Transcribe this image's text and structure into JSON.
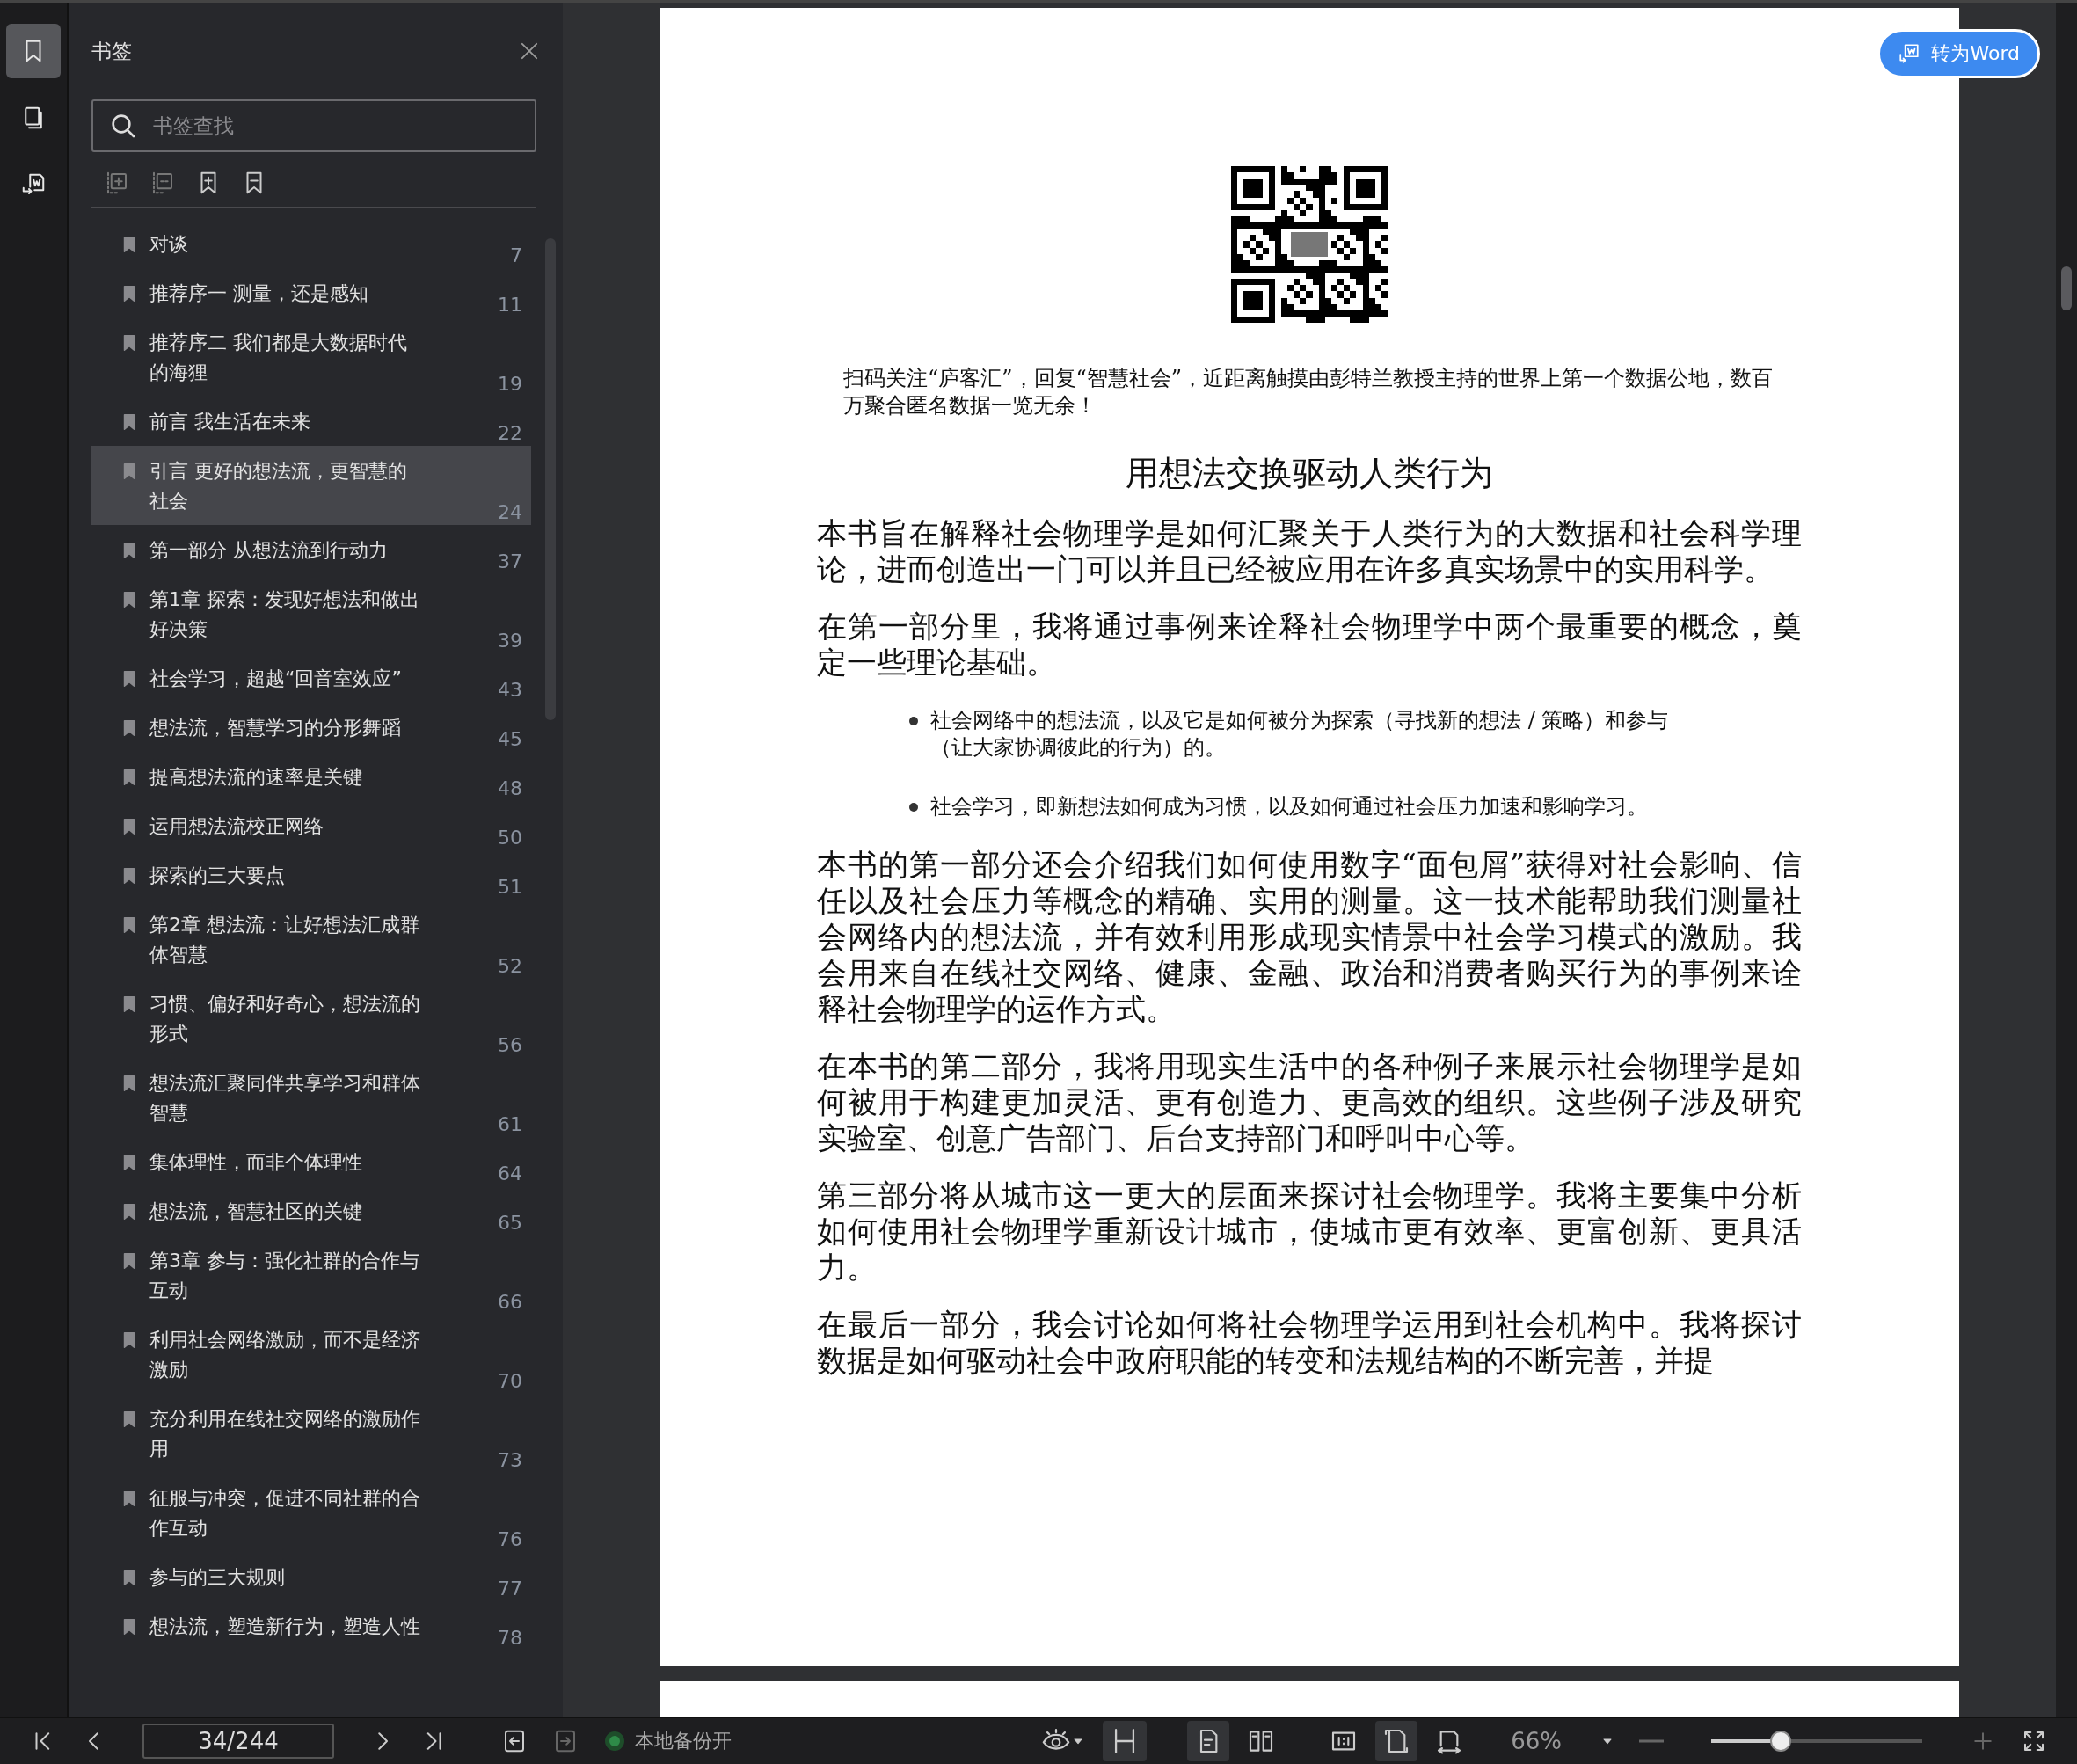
{
  "rail": [
    {
      "kind": "bookmarks",
      "selected": true
    },
    {
      "kind": "pages",
      "selected": false
    },
    {
      "kind": "convert",
      "selected": false
    }
  ],
  "sidebar": {
    "title": "书签",
    "search": {
      "placeholder": "书签查找"
    },
    "items": [
      {
        "title": "对谈",
        "page": "7",
        "selected": false
      },
      {
        "title": "推荐序一 测量，还是感知",
        "page": "11",
        "selected": false
      },
      {
        "title": "推荐序二 我们都是大数据时代的海狸",
        "page": "19",
        "selected": false
      },
      {
        "title": "前言 我生活在未来",
        "page": "22",
        "selected": false
      },
      {
        "title": "引言 更好的想法流，更智慧的社会",
        "page": "24",
        "selected": true
      },
      {
        "title": "第一部分 从想法流到行动力",
        "page": "37",
        "selected": false
      },
      {
        "title": "第1章 探索：发现好想法和做出好决策",
        "page": "39",
        "selected": false
      },
      {
        "title": "社会学习，超越“回音室效应”",
        "page": "43",
        "selected": false
      },
      {
        "title": "想法流，智慧学习的分形舞蹈",
        "page": "45",
        "selected": false
      },
      {
        "title": "提高想法流的速率是关键",
        "page": "48",
        "selected": false
      },
      {
        "title": "运用想法流校正网络",
        "page": "50",
        "selected": false
      },
      {
        "title": "探索的三大要点",
        "page": "51",
        "selected": false
      },
      {
        "title": "第2章 想法流：让好想法汇成群体智慧",
        "page": "52",
        "selected": false
      },
      {
        "title": "习惯、偏好和好奇心，想法流的形式",
        "page": "56",
        "selected": false
      },
      {
        "title": "想法流汇聚同伴共享学习和群体智慧",
        "page": "61",
        "selected": false
      },
      {
        "title": "集体理性，而非个体理性",
        "page": "64",
        "selected": false
      },
      {
        "title": "想法流，智慧社区的关键",
        "page": "65",
        "selected": false
      },
      {
        "title": "第3章 参与：强化社群的合作与互动",
        "page": "66",
        "selected": false
      },
      {
        "title": "利用社会网络激励，而不是经济激励",
        "page": "70",
        "selected": false
      },
      {
        "title": "充分利用在线社交网络的激励作用",
        "page": "73",
        "selected": false
      },
      {
        "title": "征服与冲突，促进不同社群的合作互动",
        "page": "76",
        "selected": false
      },
      {
        "title": "参与的三大规则",
        "page": "77",
        "selected": false
      },
      {
        "title": "想法流，塑造新行为，塑造人性",
        "page": "78",
        "selected": false
      }
    ]
  },
  "document": {
    "convert_button": "转为Word",
    "qr_caption": "扫码关注“庐客汇”，回复“智慧社会”，近距离触摸由彭特兰教授主持的世界上第一个数据公地，数百万聚合匿名数据一览无余！",
    "heading": "用想法交换驱动人类行为",
    "blocks": [
      {
        "kind": "paragraph",
        "text": "本书旨在解释社会物理学是如何汇聚关于人类行为的大数据和社会科学理论，进而创造出一门可以并且已经被应用在许多真实场景中的实用科学。"
      },
      {
        "kind": "paragraph",
        "text": "在第一部分里，我将通过事例来诠释社会物理学中两个最重要的概念，奠定一些理论基础。"
      },
      {
        "kind": "bullet",
        "text": "社会网络中的想法流，以及它是如何被分为探索（寻找新的想法 / 策略）和参与（让大家协调彼此的行为）的。"
      },
      {
        "kind": "bullet",
        "text": "社会学习，即新想法如何成为习惯，以及如何通过社会压力加速和影响学习。"
      },
      {
        "kind": "paragraph",
        "text": "本书的第一部分还会介绍我们如何使用数字“面包屑”获得对社会影响、信任以及社会压力等概念的精确、实用的测量。这一技术能帮助我们测量社会网络内的想法流，并有效利用形成现实情景中社会学习模式的激励。我会用来自在线社交网络、健康、金融、政治和消费者购买行为的事例来诠释社会物理学的运作方式。"
      },
      {
        "kind": "paragraph",
        "text": "在本书的第二部分，我将用现实生活中的各种例子来展示社会物理学是如何被用于构建更加灵活、更有创造力、更高效的组织。这些例子涉及研究实验室、创意广告部门、后台支持部门和呼叫中心等。"
      },
      {
        "kind": "paragraph",
        "text": "第三部分将从城市这一更大的层面来探讨社会物理学。我将主要集中分析如何使用社会物理学重新设计城市，使城市更有效率、更富创新、更具活力。"
      },
      {
        "kind": "paragraph",
        "text": "在最后一部分，我会讨论如何将社会物理学运用到社会机构中。我将探讨数据是如何驱动社会中政府职能的转变和法规结构的不断完善，并提"
      }
    ]
  },
  "status_bar": {
    "page_field": "34/244",
    "backup": {
      "label": "本地备份开",
      "on": true
    },
    "view_buttons": [
      {
        "kind": "continuous",
        "selected": true
      },
      {
        "kind": "single",
        "selected": true
      },
      {
        "kind": "double",
        "selected": false
      },
      {
        "kind": "actual",
        "selected": false
      },
      {
        "kind": "fit-page",
        "selected": true
      },
      {
        "kind": "fit-width",
        "selected": false
      }
    ],
    "zoom": {
      "reading": "66%",
      "level": 0.33
    }
  }
}
